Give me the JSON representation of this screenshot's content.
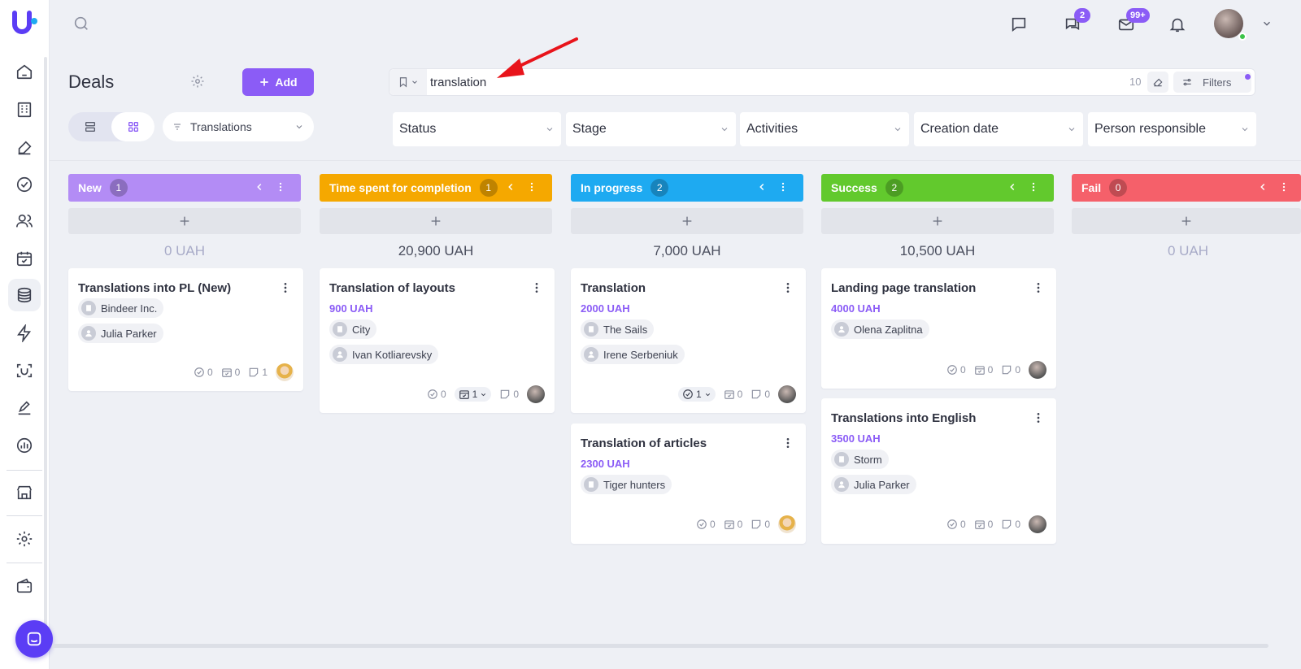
{
  "app": {
    "title": "Deals"
  },
  "colors": {
    "accent": "#8b5cf6",
    "new": "#b38cf5",
    "time": "#f5a800",
    "progress": "#1eaaf1",
    "success": "#62c92d",
    "fail": "#f5606a"
  },
  "topbar": {
    "chat_badge": "2",
    "mail_badge": "99+"
  },
  "header": {
    "title": "Deals",
    "add_label": "Add",
    "pipeline": "Translations"
  },
  "search": {
    "value": "translation",
    "count": "10",
    "filters_label": "Filters"
  },
  "filters": [
    "Status",
    "Stage",
    "Activities",
    "Creation date",
    "Person responsible"
  ],
  "columns": [
    {
      "name": "New",
      "count": "1",
      "total": "0 UAH"
    },
    {
      "name": "Time spent for completion",
      "count": "1",
      "total": "20,900 UAH"
    },
    {
      "name": "In progress",
      "count": "2",
      "total": "7,000 UAH"
    },
    {
      "name": "Success",
      "count": "2",
      "total": "10,500 UAH"
    },
    {
      "name": "Fail",
      "count": "0",
      "total": "0 UAH"
    }
  ],
  "cards": [
    {
      "title": "Translations into PL (New)",
      "company": "Bindeer Inc.",
      "person": "Julia Parker",
      "tasks": "0",
      "activities": "0",
      "notes": "1"
    },
    {
      "title": "Translation of layouts",
      "amount": "900 UAH",
      "company": "City",
      "person": "Ivan Kotliarevsky",
      "tasks": "0",
      "activities": "1",
      "notes": "0"
    },
    {
      "title": "Translation",
      "amount": "2000 UAH",
      "company": "The Sails",
      "person": "Irene Serbeniuk",
      "tasks": "1",
      "activities": "0",
      "notes": "0"
    },
    {
      "title": "Translation of articles",
      "amount": "2300 UAH",
      "company": "Tiger hunters",
      "tasks": "0",
      "activities": "0",
      "notes": "0"
    },
    {
      "title": "Landing page translation",
      "amount": "4000 UAH",
      "person": "Olena Zaplitna",
      "tasks": "0",
      "activities": "0",
      "notes": "0"
    },
    {
      "title": "Translations into English",
      "amount": "3500 UAH",
      "company": "Storm",
      "person": "Julia Parker",
      "tasks": "0",
      "activities": "0",
      "notes": "0"
    }
  ]
}
